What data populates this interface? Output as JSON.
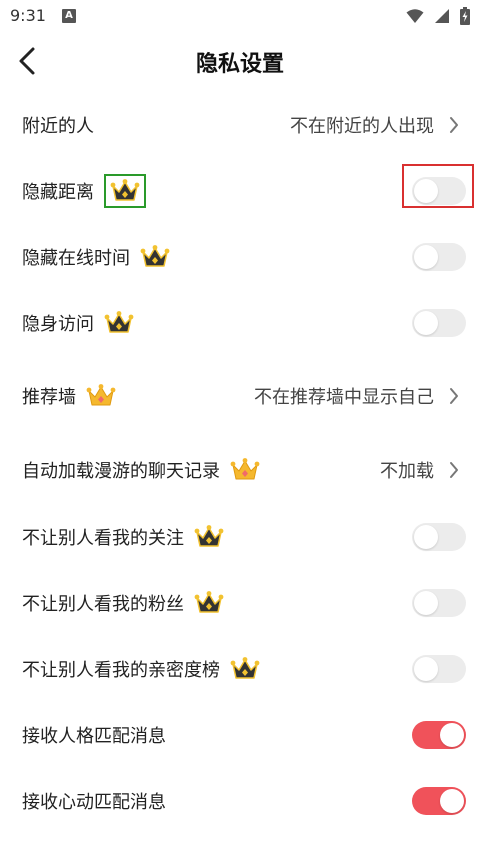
{
  "status_bar": {
    "time": "9:31",
    "notification_icon_letter": "A"
  },
  "header": {
    "title": "隐私设置"
  },
  "settings": [
    {
      "label": "附近的人",
      "vip": false,
      "type": "value",
      "value": "不在附近的人出现"
    },
    {
      "label": "隐藏距离",
      "vip": true,
      "vip_highlighted": true,
      "type": "toggle",
      "on": false,
      "toggle_highlighted": true
    },
    {
      "label": "隐藏在线时间",
      "vip": true,
      "type": "toggle",
      "on": false
    },
    {
      "label": "隐身访问",
      "vip": true,
      "type": "toggle",
      "on": false
    },
    {
      "label": "推荐墙",
      "vip": true,
      "type": "value",
      "value": "不在推荐墙中显示自己"
    },
    {
      "label": "自动加载漫游的聊天记录",
      "vip": true,
      "type": "value",
      "value": "不加载"
    },
    {
      "label": "不让别人看我的关注",
      "vip": true,
      "type": "toggle",
      "on": false
    },
    {
      "label": "不让别人看我的粉丝",
      "vip": true,
      "type": "toggle",
      "on": false
    },
    {
      "label": "不让别人看我的亲密度榜",
      "vip": true,
      "type": "toggle",
      "on": false
    },
    {
      "label": "接收人格匹配消息",
      "vip": false,
      "type": "toggle",
      "on": true
    },
    {
      "label": "接收心动匹配消息",
      "vip": false,
      "type": "toggle",
      "on": true
    }
  ],
  "colors": {
    "toggle_on": "#f0525a",
    "toggle_off": "#ececec",
    "highlight_green": "#2a9a2a",
    "highlight_red": "#d93030"
  }
}
